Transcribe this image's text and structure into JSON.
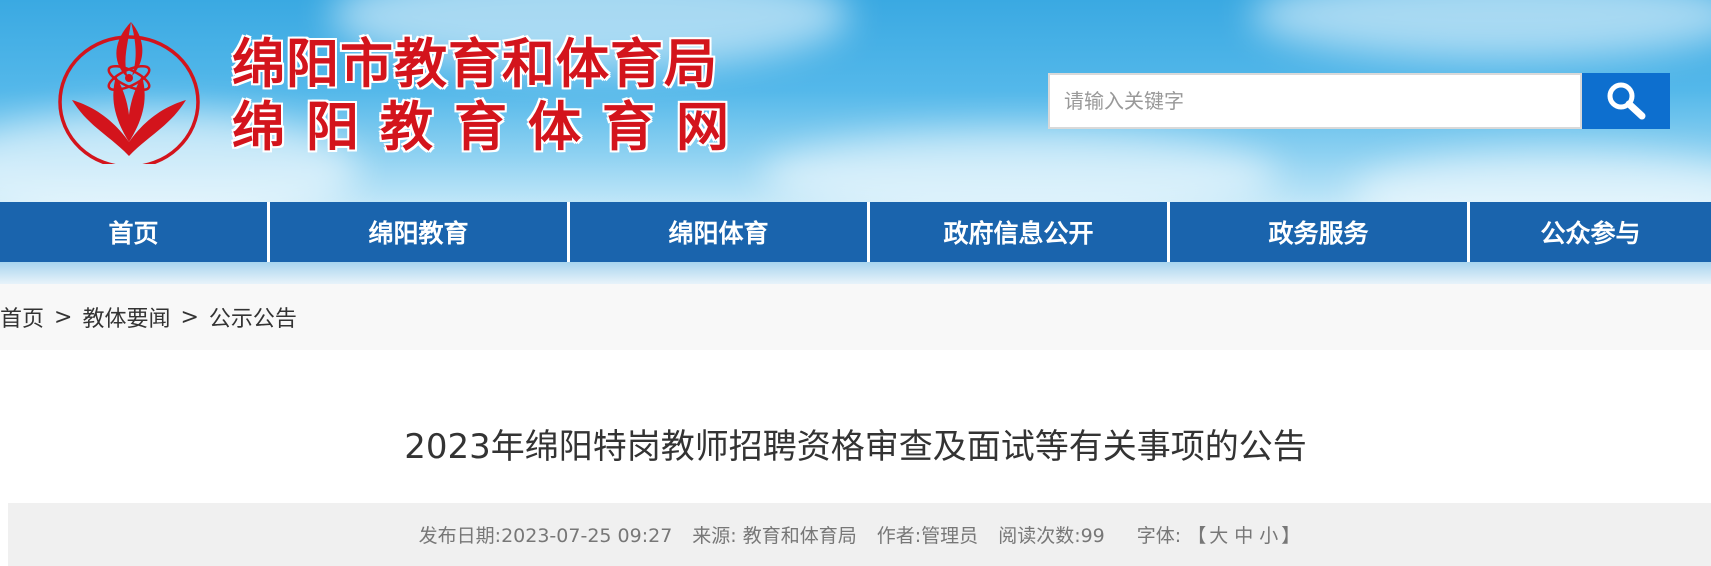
{
  "header": {
    "title_line1": "绵阳市教育和体育局",
    "title_line2": "绵阳教育体育网",
    "logo_icon": "mianyang-education-emblem-icon",
    "brand_red": "#d3141c"
  },
  "search": {
    "placeholder": "请输入关键字",
    "value": "",
    "button_icon": "search-icon",
    "button_color": "#0d6fcf"
  },
  "nav": {
    "color": "#1a64ad",
    "items": [
      {
        "label": "首页"
      },
      {
        "label": "绵阳教育"
      },
      {
        "label": "绵阳体育"
      },
      {
        "label": "政府信息公开"
      },
      {
        "label": "政务服务"
      },
      {
        "label": "公众参与"
      }
    ]
  },
  "breadcrumb": {
    "items": [
      "首页",
      "教体要闻",
      "公示公告"
    ],
    "separator": ">"
  },
  "article": {
    "title": "2023年绵阳特岗教师招聘资格审查及面试等有关事项的公告",
    "meta": {
      "date_label": "发布日期:",
      "date_value": "2023-07-25 09:27",
      "source_label": "来源:",
      "source_value": "教育和体育局",
      "author_label": "作者:",
      "author_value": "管理员",
      "views_label": "阅读次数:",
      "views_value": "99",
      "font_label": "字体:",
      "font_open": "【",
      "font_large": "大",
      "font_medium": "中",
      "font_small": "小",
      "font_close": "】"
    }
  }
}
